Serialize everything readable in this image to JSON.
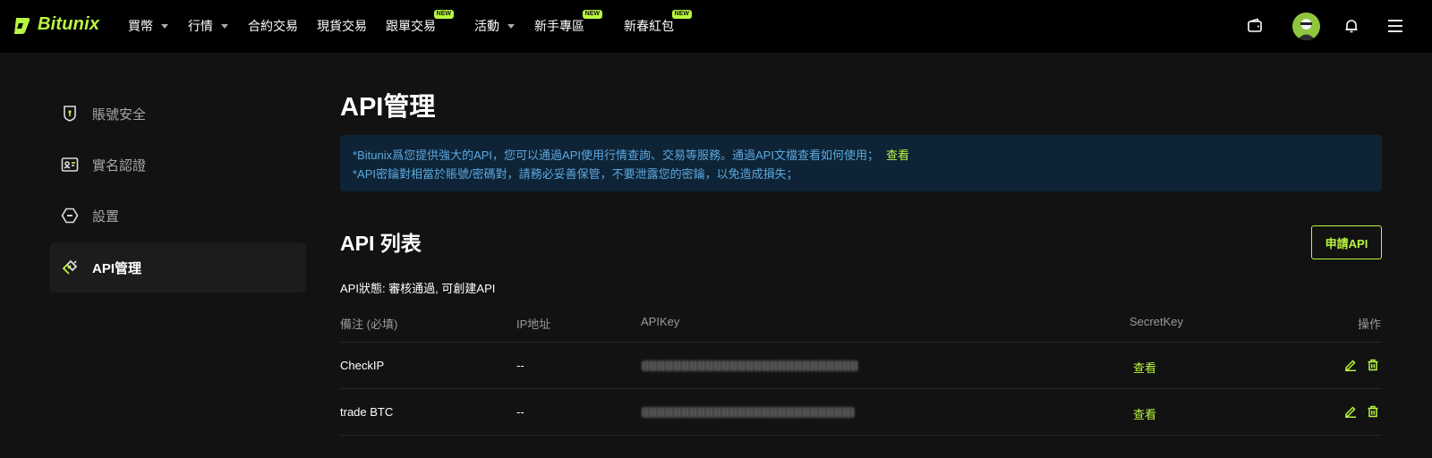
{
  "header": {
    "logo_text": "Bitunix",
    "nav": [
      {
        "label": "買幣",
        "dropdown": true
      },
      {
        "label": "行情",
        "dropdown": true
      },
      {
        "label": "合約交易"
      },
      {
        "label": "現貨交易"
      },
      {
        "label": "跟單交易",
        "badge": "NEW"
      },
      {
        "label": "活動",
        "dropdown": true
      },
      {
        "label": "新手專區",
        "badge": "NEW"
      },
      {
        "label": "新春紅包",
        "badge": "NEW"
      }
    ]
  },
  "sidebar": {
    "items": [
      {
        "label": "賬號安全",
        "icon": "shield-icon"
      },
      {
        "label": "實名認證",
        "icon": "id-card-icon"
      },
      {
        "label": "設置",
        "icon": "settings-icon"
      },
      {
        "label": "API管理",
        "icon": "api-link-icon",
        "active": true
      }
    ]
  },
  "main": {
    "title": "API管理",
    "notice": {
      "line1": "*Bitunix爲您提供強大的API，您可以通過API使用行情查詢、交易等服務。通過API文檔查看如何使用；",
      "line1_link": "查看",
      "line2": "*API密鑰對相當於賬號/密碼對，請務必妥善保管，不要泄露您的密鑰，以免造成損失；"
    },
    "section_title": "API 列表",
    "apply_button": "申請API",
    "api_status": "API狀態: 審核通過, 可創建API",
    "table": {
      "headers": [
        "備注 (必填)",
        "IP地址",
        "APIKey",
        "SecretKey",
        "操作"
      ],
      "rows": [
        {
          "note": "CheckIP",
          "ip": "--",
          "secret_action": "查看"
        },
        {
          "note": "trade BTC",
          "ip": "--",
          "secret_action": "查看"
        }
      ]
    }
  },
  "colors": {
    "accent": "#b9f641",
    "notice_bg": "#0e2436",
    "notice_text": "#5ca8e0"
  }
}
